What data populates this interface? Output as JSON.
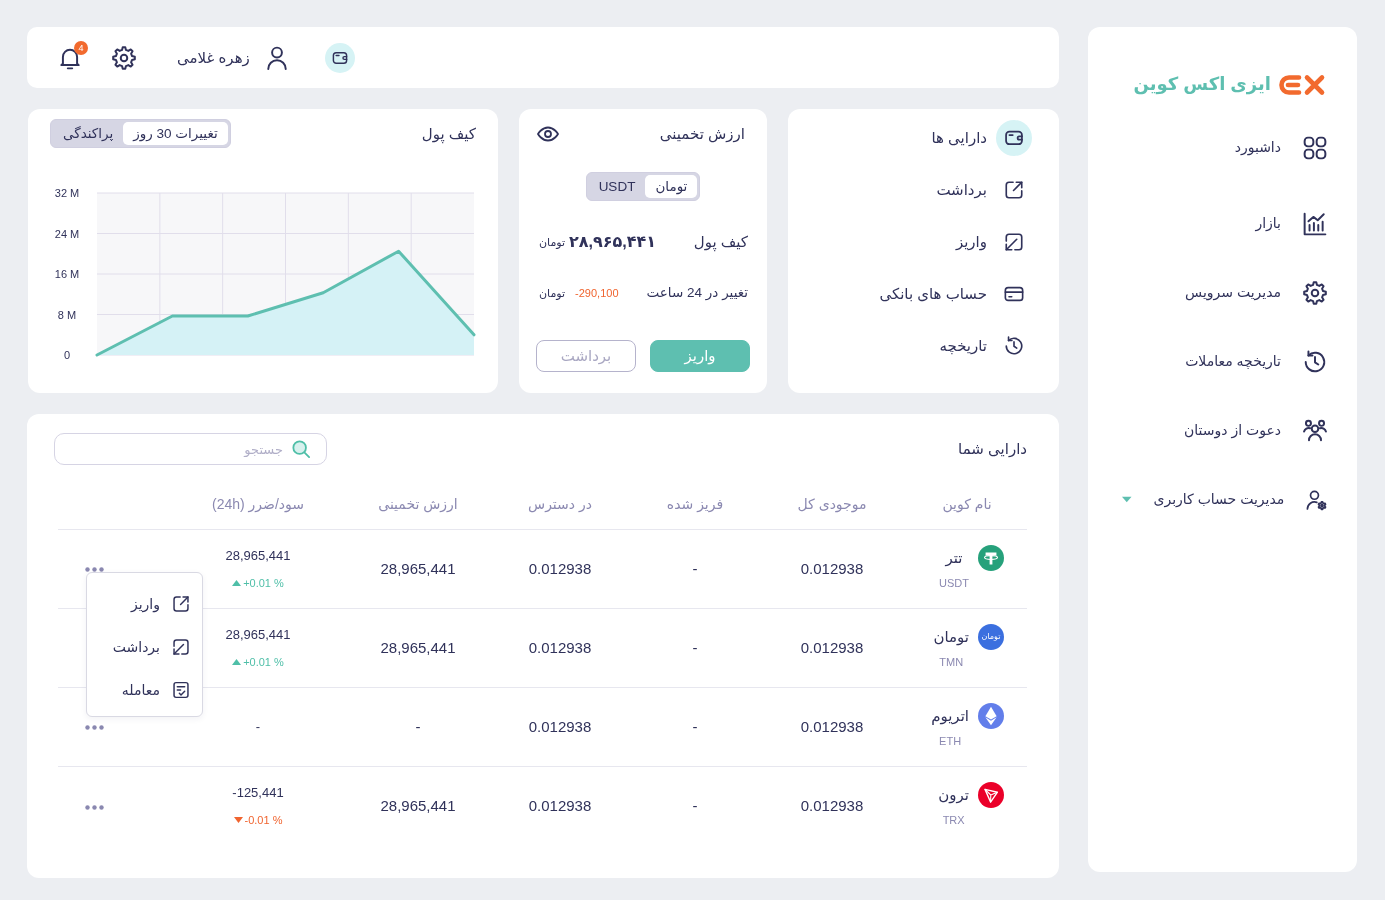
{
  "sidebar": {
    "logo": {
      "text": "ایزی اکس کوین"
    },
    "items": [
      {
        "label": "داشبورد",
        "kind": "link",
        "selected": false
      },
      {
        "label": "بازار",
        "kind": "link",
        "selected": false
      },
      {
        "label": "مدیریت سرویس",
        "kind": "link",
        "selected": false
      },
      {
        "label": "تاریخچه معاملات",
        "kind": "link",
        "selected": false
      },
      {
        "label": "دعوت از دوستان",
        "kind": "link",
        "selected": false
      },
      {
        "label": "مدیریت حساب کاربری",
        "kind": "dropdown",
        "selected": false
      }
    ]
  },
  "header": {
    "user_name": "زهره غلامی",
    "notification_count": "4"
  },
  "wallet_menu": {
    "items": [
      {
        "label": "دارایی ها",
        "selected": true
      },
      {
        "label": "برداشت",
        "selected": false
      },
      {
        "label": "واریز",
        "selected": false
      },
      {
        "label": "حساب های بانکی",
        "selected": false
      },
      {
        "label": "تاریخچه",
        "selected": false
      }
    ]
  },
  "estimated_value": {
    "title": "ارزش تخمینی",
    "currency_toggle": [
      {
        "label": "تومان",
        "selected": true
      },
      {
        "label": "USDT",
        "selected": false
      }
    ],
    "wallet_label": "کیف پول",
    "wallet_amount": "۲۸,۹۶۵,۴۴۱",
    "wallet_unit": "تومان",
    "change_label": "تغییر در 24 ساعت",
    "change": {
      "text": "-290,100",
      "negative": true
    },
    "change_unit": "تومان",
    "buttons": [
      {
        "label": "واریز",
        "kind": "primary"
      },
      {
        "label": "برداشت",
        "kind": "outline"
      }
    ]
  },
  "wallet_chart": {
    "title": "کیف پول",
    "view_toggle": [
      {
        "label": "تغییرات 30 روز",
        "selected": true
      },
      {
        "label": "پراکندگی",
        "selected": false
      }
    ],
    "chart_data": {
      "type": "area",
      "grid": true,
      "ylim": [
        0,
        32
      ],
      "yticks": [
        {
          "value": 0,
          "label": "0"
        },
        {
          "value": 8,
          "label": "8 M"
        },
        {
          "value": 16,
          "label": "16 M"
        },
        {
          "value": 24,
          "label": "24 M"
        },
        {
          "value": 32,
          "label": "32 M"
        }
      ],
      "series": [
        {
          "color": "#5ebfb0",
          "values": [
            0,
            7.7,
            7.7,
            12.3,
            20.5,
            4.0
          ]
        }
      ]
    }
  },
  "assets": {
    "title": "دارایی شما",
    "search": {
      "placeholder": "جستجو"
    },
    "columns": [
      "نام کوین",
      "موجودی کل",
      "فریز شده",
      "در دسترس",
      "ارزش تخمینی",
      "سود/ضرر (24h)"
    ],
    "rows": [
      {
        "coin": "تتر",
        "symbol": "USDT",
        "color": "#26a17b",
        "total": "0.012938",
        "frozen": "-",
        "available": "0.012938",
        "estimated_value": "28,965,441",
        "profit": "28,965,441",
        "change": {
          "text": "+0.01 %",
          "negative": false
        },
        "more_button": true,
        "menu": {
          "items": [
            {
              "label": "واریز"
            },
            {
              "label": "برداشت"
            },
            {
              "label": "معامله"
            }
          ]
        }
      },
      {
        "coin": "تومان",
        "symbol": "TMN",
        "logo_text": "تومان",
        "color": "#3b6fdf",
        "total": "0.012938",
        "frozen": "-",
        "available": "0.012938",
        "estimated_value": "28,965,441",
        "profit": "28,965,441",
        "change": {
          "text": "+0.01 %",
          "negative": false
        },
        "more_button": false
      },
      {
        "coin": "اتریوم",
        "symbol": "ETH",
        "color": "#627eea",
        "total": "0.012938",
        "frozen": "-",
        "available": "0.012938",
        "estimated_value": "-",
        "profit": "-",
        "more_button": true
      },
      {
        "coin": "ترون",
        "symbol": "TRX",
        "color": "#eb0029",
        "total": "0.012938",
        "frozen": "-",
        "available": "0.012938",
        "estimated_value": "28,965,441",
        "profit": "-125,441",
        "change": {
          "text": "-0.01 %",
          "negative": true
        },
        "more_button": true
      }
    ]
  }
}
